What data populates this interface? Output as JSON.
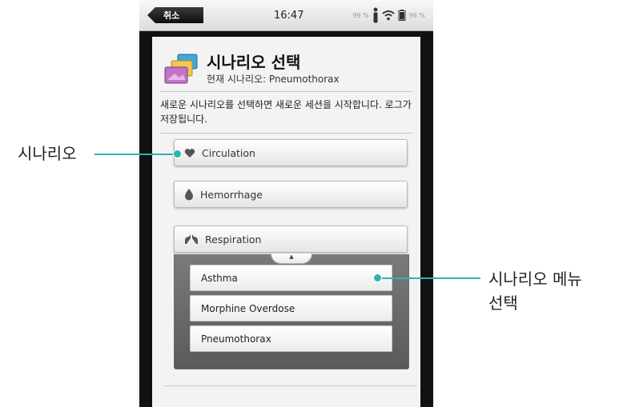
{
  "status_bar": {
    "cancel_label": "취소",
    "time": "16:47",
    "signal_text": "99 %",
    "battery_text": "96 %"
  },
  "header": {
    "title": "시나리오 선택",
    "subtitle": "현재 시나리오: Pneumothorax"
  },
  "description": "새로운 시나리오를 선택하면 새로운 세션을 시작합니다. 로그가 저장됩니다.",
  "categories": [
    {
      "label": "Circulation",
      "icon": "heart-icon"
    },
    {
      "label": "Hemorrhage",
      "icon": "drop-icon"
    },
    {
      "label": "Respiration",
      "icon": "lungs-icon"
    }
  ],
  "submenu": {
    "items": [
      "Asthma",
      "Morphine Overdose",
      "Pneumothorax"
    ]
  },
  "annotations": {
    "left": "시나리오",
    "right_line1": "시나리오 메뉴",
    "right_line2": "선택"
  },
  "colors": {
    "annotation_accent": "#2bb4b0"
  }
}
